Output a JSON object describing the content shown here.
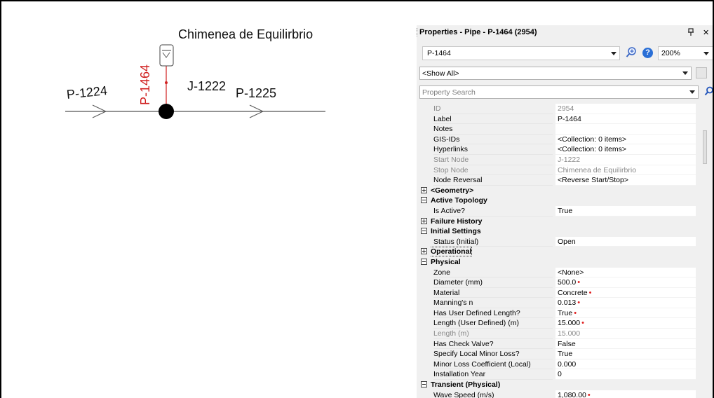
{
  "diagram": {
    "tank_label": "Chimenea de Equilirbrio",
    "pipe_left_label": "P-1224",
    "junction_label": "J-1222",
    "pipe_right_label": "P-1225",
    "riser_label": "P-1464",
    "riser_color": "#d02020"
  },
  "panel": {
    "title": "Properties - Pipe - P-1464 (2954)",
    "pin_icon": "pin-icon",
    "close_glyph": "✕",
    "element_select": "P-1464",
    "zoom_level": "200%",
    "help_glyph": "?",
    "filter": "<Show All>",
    "search_placeholder": "Property Search"
  },
  "rows": [
    {
      "type": "prop",
      "name": "ID",
      "value": "2954",
      "dim": true
    },
    {
      "type": "prop",
      "name": "Label",
      "value": "P-1464"
    },
    {
      "type": "prop",
      "name": "Notes",
      "value": ""
    },
    {
      "type": "prop",
      "name": "GIS-IDs",
      "value": "<Collection: 0 items>"
    },
    {
      "type": "prop",
      "name": "Hyperlinks",
      "value": "<Collection: 0 items>"
    },
    {
      "type": "prop",
      "name": "Start Node",
      "value": "J-1222",
      "dim": true
    },
    {
      "type": "prop",
      "name": "Stop Node",
      "value": "Chimenea de Equilirbrio",
      "dim": true
    },
    {
      "type": "prop",
      "name": "Node Reversal",
      "value": "<Reverse Start/Stop>"
    },
    {
      "type": "cat",
      "name": "<Geometry>",
      "expanded": false
    },
    {
      "type": "cat",
      "name": "Active Topology",
      "expanded": true
    },
    {
      "type": "prop",
      "name": "Is Active?",
      "value": "True"
    },
    {
      "type": "cat",
      "name": "Failure History",
      "expanded": false
    },
    {
      "type": "cat",
      "name": "Initial Settings",
      "expanded": true
    },
    {
      "type": "prop",
      "name": "Status (Initial)",
      "value": "Open"
    },
    {
      "type": "cat",
      "name": "Operational",
      "expanded": false,
      "focused": true
    },
    {
      "type": "cat",
      "name": "Physical",
      "expanded": true
    },
    {
      "type": "prop",
      "name": "Zone",
      "value": "<None>"
    },
    {
      "type": "prop",
      "name": "Diameter (mm)",
      "value": "500.0",
      "mark": true
    },
    {
      "type": "prop",
      "name": "Material",
      "value": "Concrete",
      "mark": true
    },
    {
      "type": "prop",
      "name": "Manning's n",
      "value": "0.013",
      "mark": true
    },
    {
      "type": "prop",
      "name": "Has User Defined Length?",
      "value": "True",
      "mark": true
    },
    {
      "type": "prop",
      "name": "Length (User Defined) (m)",
      "value": "15.000",
      "mark": true
    },
    {
      "type": "prop",
      "name": "Length (m)",
      "value": "15.000",
      "dim": true
    },
    {
      "type": "prop",
      "name": "Has Check Valve?",
      "value": "False"
    },
    {
      "type": "prop",
      "name": "Specify Local Minor Loss?",
      "value": "True"
    },
    {
      "type": "prop",
      "name": "Minor Loss Coefficient (Local)",
      "value": "0.000"
    },
    {
      "type": "prop",
      "name": "Installation Year",
      "value": "0"
    },
    {
      "type": "cat",
      "name": "Transient (Physical)",
      "expanded": true
    },
    {
      "type": "prop",
      "name": "Wave Speed (m/s)",
      "value": "1,080.00",
      "mark": true
    }
  ]
}
